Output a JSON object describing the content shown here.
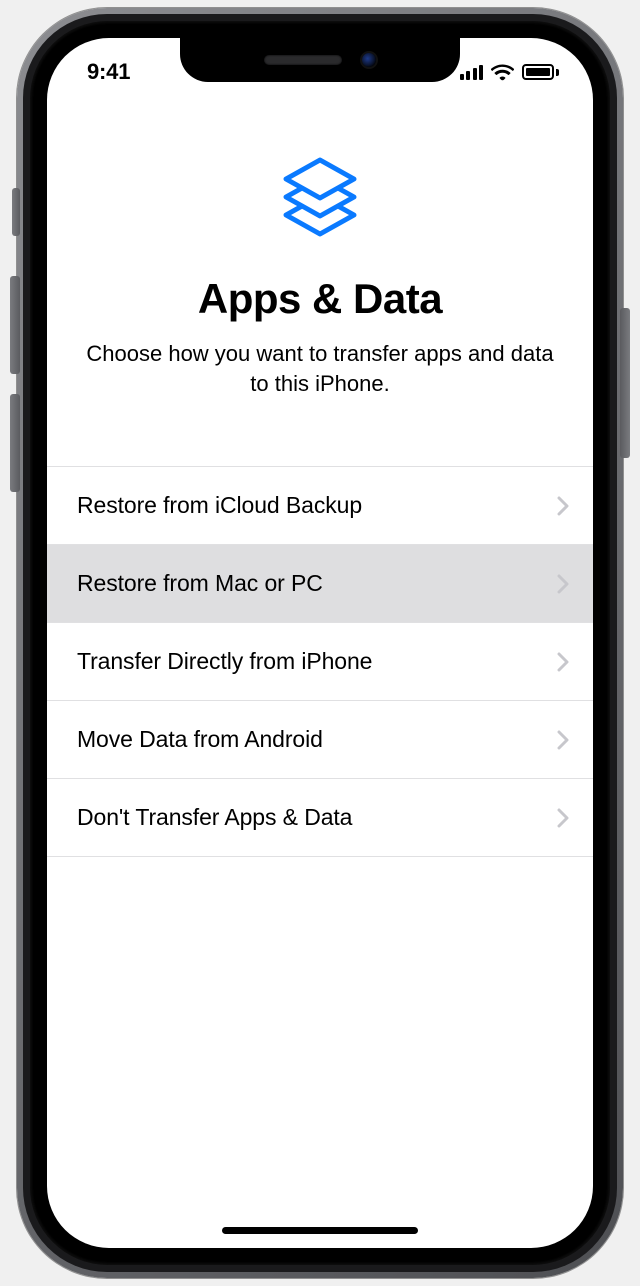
{
  "status": {
    "time": "9:41"
  },
  "header": {
    "title": "Apps & Data",
    "subtitle": "Choose how you want to transfer apps and data to this iPhone."
  },
  "options": [
    {
      "label": "Restore from iCloud Backup",
      "selected": false
    },
    {
      "label": "Restore from Mac or PC",
      "selected": true
    },
    {
      "label": "Transfer Directly from iPhone",
      "selected": false
    },
    {
      "label": "Move Data from Android",
      "selected": false
    },
    {
      "label": "Don't Transfer Apps & Data",
      "selected": false
    }
  ],
  "colors": {
    "accent": "#0a7aff",
    "chevron": "#c7c7cc",
    "row_selected_bg": "#dedee0"
  }
}
